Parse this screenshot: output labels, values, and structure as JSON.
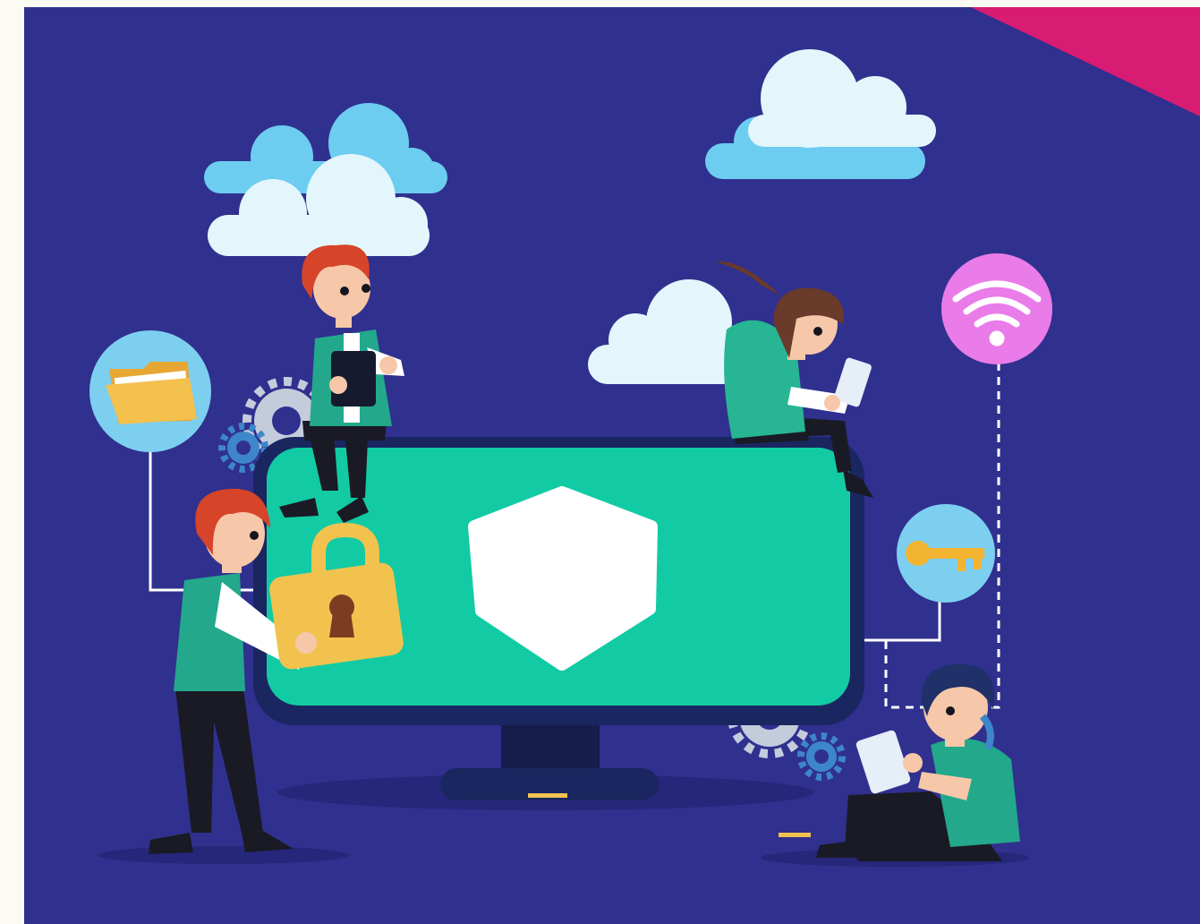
{
  "illustration": {
    "theme": "cybersecurity-teamwork",
    "colors": {
      "page_margin": "#fbfbf4",
      "background": "#30308f",
      "corner_accent": "#d81b73",
      "cloud_front": "#e3f6fb",
      "cloud_back": "#6ccdf0",
      "monitor_frame": "#1a2660",
      "monitor_screen": "#12cba4",
      "shield": "#ffffff",
      "gear": "#c4ccdc",
      "gear_blue": "#3d86c9",
      "hair_red": "#d6442a",
      "hair_brown": "#6a3a2a",
      "hair_navy": "#1f3168",
      "shirt_green": "#24a88b",
      "hoodie_green": "#27b593",
      "skin": "#f6c7a8",
      "trousers": "#1a1a24",
      "padlock": "#f2c24f",
      "folder": "#f4c04e",
      "key": "#f2b431",
      "wifi_bubble": "#e97ce9",
      "icon_bubble": "#7dcff0",
      "connector_line": "#ffffff"
    },
    "icons": [
      "folder-icon",
      "wifi-icon",
      "key-icon",
      "padlock-icon",
      "shield-icon",
      "gear-icon"
    ],
    "people": [
      "boy-on-monitor-with-tablet",
      "boy-holding-padlock",
      "girl-on-monitor-with-laptop",
      "boy-sitting-with-laptop"
    ]
  }
}
